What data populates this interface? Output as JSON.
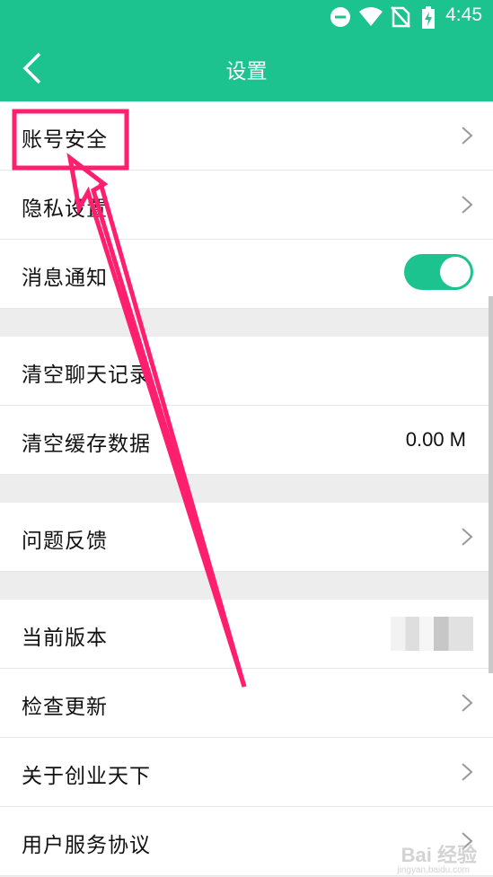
{
  "status_bar": {
    "time": "4:45",
    "icons": [
      "do-not-disturb-icon",
      "wifi-icon",
      "no-sim-icon",
      "battery-charging-icon"
    ]
  },
  "header": {
    "title": "设置",
    "back_icon": "chevron-left-icon"
  },
  "settings": {
    "account_security": "账号安全",
    "privacy": "隐私设置",
    "notifications": "消息通知",
    "notifications_enabled": true,
    "clear_chat": "清空聊天记录",
    "clear_cache": "清空缓存数据",
    "cache_size": "0.00 M",
    "feedback": "问题反馈",
    "current_version": "当前版本",
    "check_update": "检查更新",
    "about": "关于创业天下",
    "user_agreement": "用户服务协议"
  },
  "colors": {
    "accent": "#1dc38e",
    "annotation": "#ff1f6e"
  },
  "watermark": {
    "text": "Bai 经验",
    "sub": "jingyan.baidu.com"
  }
}
